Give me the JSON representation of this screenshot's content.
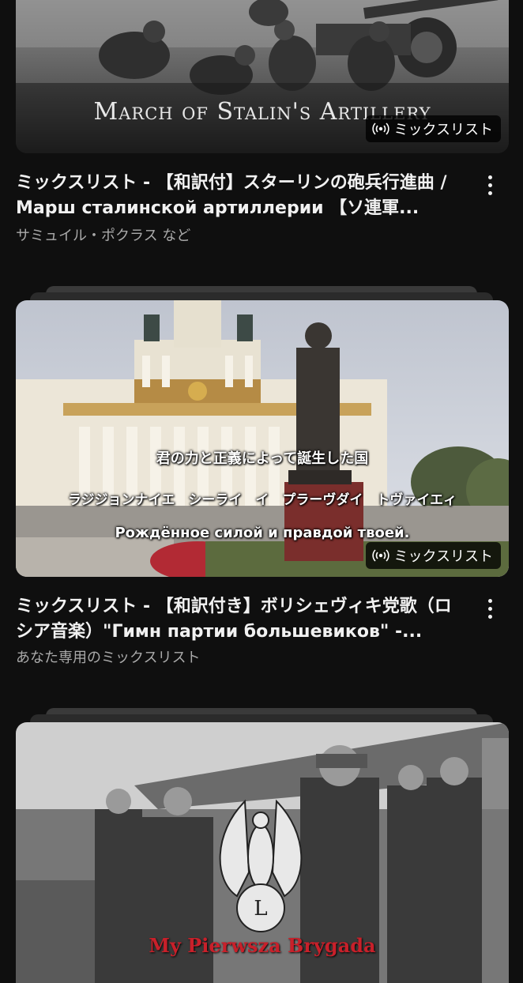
{
  "videos": [
    {
      "thumb_caption": "March of Stalin's Artillery",
      "badge": "ミックスリスト",
      "title": "ミックスリスト - 【和訳付】スターリンの砲兵行進曲 / Марш сталинской артиллерии 【ソ連軍...",
      "subtitle": "サミュイル・ポクラス など"
    },
    {
      "lyric_jp": "君の力と正義によって誕生した国",
      "lyric_kana": "ラジジョンナイエ　シーライ　イ　プラーヴダイ　トヴァイエィ",
      "lyric_ru": "Рождённое силой и правдой твоей.",
      "badge": "ミックスリスト",
      "title": "ミックスリスト - 【和訳付き】ボリシェヴィキ党歌（ロシア音楽）\"Гимн партии большевиков\" -...",
      "subtitle": "あなた専用のミックスリスト"
    },
    {
      "thumb_caption": "My Pierwsza Brygada"
    }
  ]
}
